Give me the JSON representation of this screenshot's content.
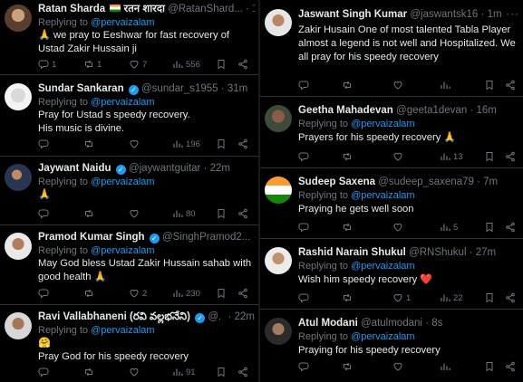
{
  "left_column": [
    {
      "name": "Ratan Sharda",
      "name_extra": "रतन शारदा",
      "handle": "@RatanShard...",
      "time": "1h",
      "replying_to": "Replying to",
      "mention": "@pervaizalam",
      "text": "🙏 we pray to Eeshwar for fast recovery of Ustad Zakir Hussain ji",
      "replies": "1",
      "reposts": "1",
      "likes": "7",
      "views": "556"
    },
    {
      "name": "Sundar Sankaran",
      "handle": "@sundar_s1955",
      "time": "31m",
      "replying_to": "Replying to",
      "mention": "@pervaizalam",
      "text": "Pray for Ustad s speedy recovery.\nHis music is divine.",
      "replies": "",
      "reposts": "",
      "likes": "",
      "views": "196"
    },
    {
      "name": "Jaywant Naidu",
      "handle": "@jaywantguitar",
      "time": "22m",
      "replying_to": "Replying to",
      "mention": "@pervaizalam",
      "text": "🙏",
      "replies": "",
      "reposts": "",
      "likes": "",
      "views": "80"
    },
    {
      "name": "Pramod Kumar Singh",
      "handle": "@SinghPramod2...",
      "time": "21m",
      "replying_to": "Replying to",
      "mention": "@pervaizalam",
      "text": "May God bless Ustad Zakir Hussain sahab with good health 🙏",
      "replies": "",
      "reposts": "",
      "likes": "2",
      "views": "230"
    },
    {
      "name": "Ravi Vallabhaneni (రవి వల్లభనేని)",
      "handle": "@...",
      "time": "22m",
      "replying_to": "Replying to",
      "mention": "@pervaizalam",
      "text": "🤗\nPray God for his speedy recovery",
      "replies": "",
      "reposts": "",
      "likes": "",
      "views": "91"
    }
  ],
  "right_column": [
    {
      "name": "Jaswant Singh Kumar",
      "handle": "@jaswantsk16",
      "time": "1m",
      "replying_to": "",
      "mention": "",
      "text": "Zakir Husain One of most talented Tabla Player almost a legend is not well and Hospitalized.  We all pray for his speedy recovery",
      "replies": "",
      "reposts": "",
      "likes": "",
      "views": ""
    },
    {
      "name": "Geetha Mahadevan",
      "handle": "@geeta1devan",
      "time": "16m",
      "replying_to": "Replying to",
      "mention": "@pervaizalam",
      "text": "Prayers for his speedy recovery 🙏",
      "replies": "",
      "reposts": "",
      "likes": "",
      "views": "13"
    },
    {
      "name": "Sudeep Saxena",
      "handle": "@sudeep_saxena79",
      "time": "7m",
      "replying_to": "Replying to",
      "mention": "@pervaizalam",
      "text": "Praying he gets well soon",
      "replies": "",
      "reposts": "",
      "likes": "",
      "views": "5"
    },
    {
      "name": "Rashid Narain Shukul",
      "handle": "@RNShukul",
      "time": "27m",
      "replying_to": "Replying to",
      "mention": "@pervaizalam",
      "text": "Wish him speedy recovery ❤️",
      "replies": "",
      "reposts": "",
      "likes": "1",
      "views": "22"
    },
    {
      "name": "Atul Modani",
      "handle": "@atulmodani",
      "time": "8s",
      "replying_to": "Replying to",
      "mention": "@pervaizalam",
      "text": "Praying for his speedy recovery",
      "replies": "",
      "reposts": "",
      "likes": "",
      "views": ""
    }
  ],
  "separator": "·",
  "more": "···",
  "colors": {
    "background": "#000000",
    "text": "#e7e9ea",
    "secondary": "#71767b",
    "link": "#1d9bf0",
    "divider": "#2f3336"
  },
  "icons": [
    "verified-badge-icon",
    "reply-icon",
    "repost-icon",
    "like-icon",
    "views-icon",
    "bookmark-icon",
    "share-icon",
    "more-icon"
  ]
}
